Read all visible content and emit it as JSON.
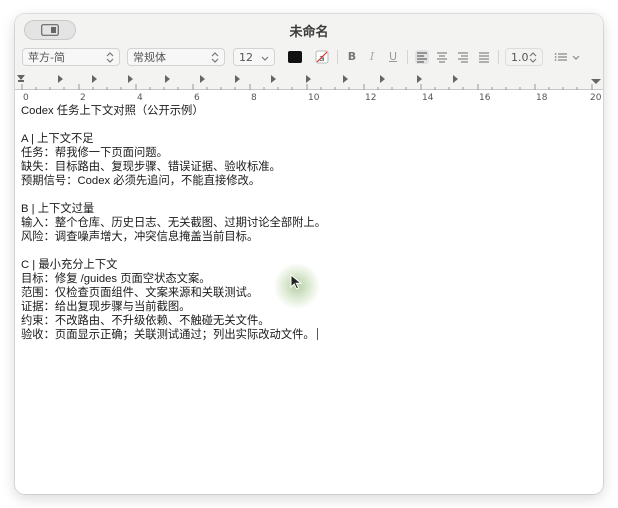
{
  "window": {
    "title": "未命名"
  },
  "toolbar": {
    "font_family": "苹方-简",
    "font_style": "常规体",
    "font_size": "12",
    "text_color": "#111111",
    "bold_label": "B",
    "italic_label": "I",
    "underline_label": "U",
    "line_spacing": "1.0"
  },
  "ruler": {
    "labels": [
      "0",
      "2",
      "4",
      "6",
      "8",
      "10",
      "12",
      "14",
      "16",
      "18",
      "20"
    ]
  },
  "document": {
    "lines": [
      "Codex 任务上下文对照（公开示例）",
      "",
      "A | 上下文不足",
      "任务：帮我修一下页面问题。",
      "缺失：目标路由、复现步骤、错误证据、验收标准。",
      "预期信号：Codex 必须先追问，不能直接修改。",
      "",
      "B | 上下文过量",
      "输入：整个仓库、历史日志、无关截图、过期讨论全部附上。",
      "风险：调查噪声增大，冲突信息掩盖当前目标。",
      "",
      "C | 最小充分上下文",
      "目标：修复 /guides 页面空状态文案。",
      "范围：仅检查页面组件、文案来源和关联测试。",
      "证据：给出复现步骤与当前截图。",
      "约束：不改路由、不升级依赖、不触碰无关文件。",
      "验收：页面显示正确；关联测试通过；列出实际改动文件。"
    ]
  },
  "colors": {
    "accent": "#1f5fd6",
    "chrome_bg": "#f3f4f2"
  }
}
